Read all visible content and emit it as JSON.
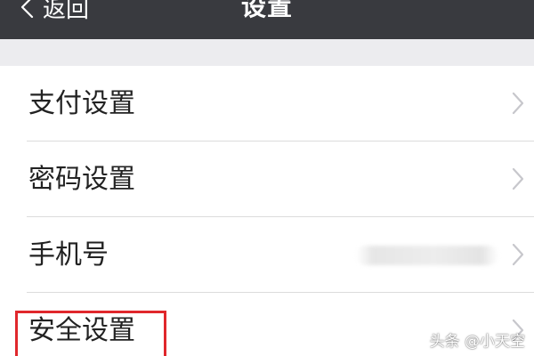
{
  "navbar": {
    "back_label": "返回",
    "title": "设置",
    "background_color": "#393a3f"
  },
  "settings": {
    "items": [
      {
        "label": "支付设置",
        "icon": "chevron-right-icon"
      },
      {
        "label": "密码设置",
        "icon": "chevron-right-icon"
      },
      {
        "label": "手机号",
        "icon": "chevron-right-icon"
      },
      {
        "label": "安全设置",
        "icon": "chevron-right-icon"
      }
    ]
  },
  "annotation": {
    "highlight_color": "#e0272c"
  },
  "watermark": {
    "text": "头条 @小天空"
  }
}
